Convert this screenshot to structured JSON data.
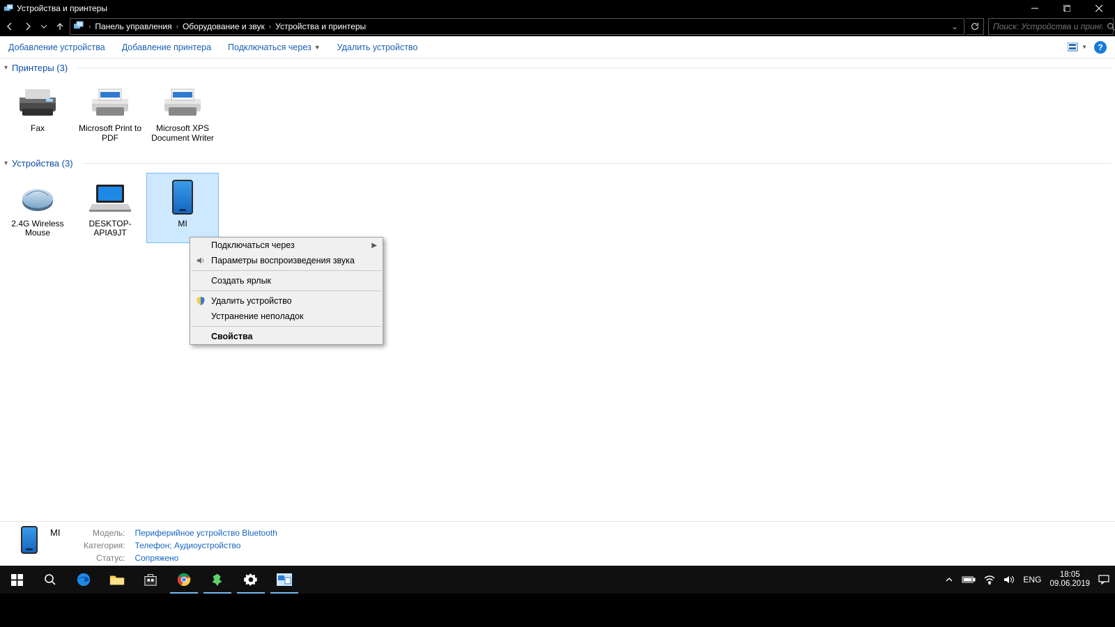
{
  "window": {
    "title": "Устройства и принтеры"
  },
  "breadcrumbs": {
    "a": "Панель управления",
    "b": "Оборудование и звук",
    "c": "Устройства и принтеры"
  },
  "search": {
    "placeholder": "Поиск: Устройства и принте..."
  },
  "commands": {
    "add_device": "Добавление устройства",
    "add_printer": "Добавление принтера",
    "connect_via": "Подключаться через",
    "remove_device": "Удалить устройство"
  },
  "groups": {
    "printers": {
      "title": "Принтеры (3)",
      "items": [
        {
          "label": "Fax"
        },
        {
          "label": "Microsoft Print to PDF"
        },
        {
          "label": "Microsoft XPS Document Writer"
        }
      ]
    },
    "devices": {
      "title": "Устройства (3)",
      "items": [
        {
          "label": "2.4G Wireless Mouse"
        },
        {
          "label": "DESKTOP-APIA9JT"
        },
        {
          "label": "MI",
          "selected": true
        }
      ]
    }
  },
  "context_menu": {
    "connect_via": "Подключаться через",
    "sound_params": "Параметры воспроизведения звука",
    "create_shortcut": "Создать ярлык",
    "remove_device": "Удалить устройство",
    "troubleshoot": "Устранение неполадок",
    "properties": "Свойства"
  },
  "details": {
    "name": "MI",
    "model_k": "Модель:",
    "model_v": "Периферийное устройство Bluetooth",
    "category_k": "Категория:",
    "category_v": "Телефон; Аудиоустройство",
    "status_k": "Статус:",
    "status_v": "Сопряжено"
  },
  "tray": {
    "lang": "ENG",
    "time": "18:05",
    "date": "09.06.2019"
  }
}
